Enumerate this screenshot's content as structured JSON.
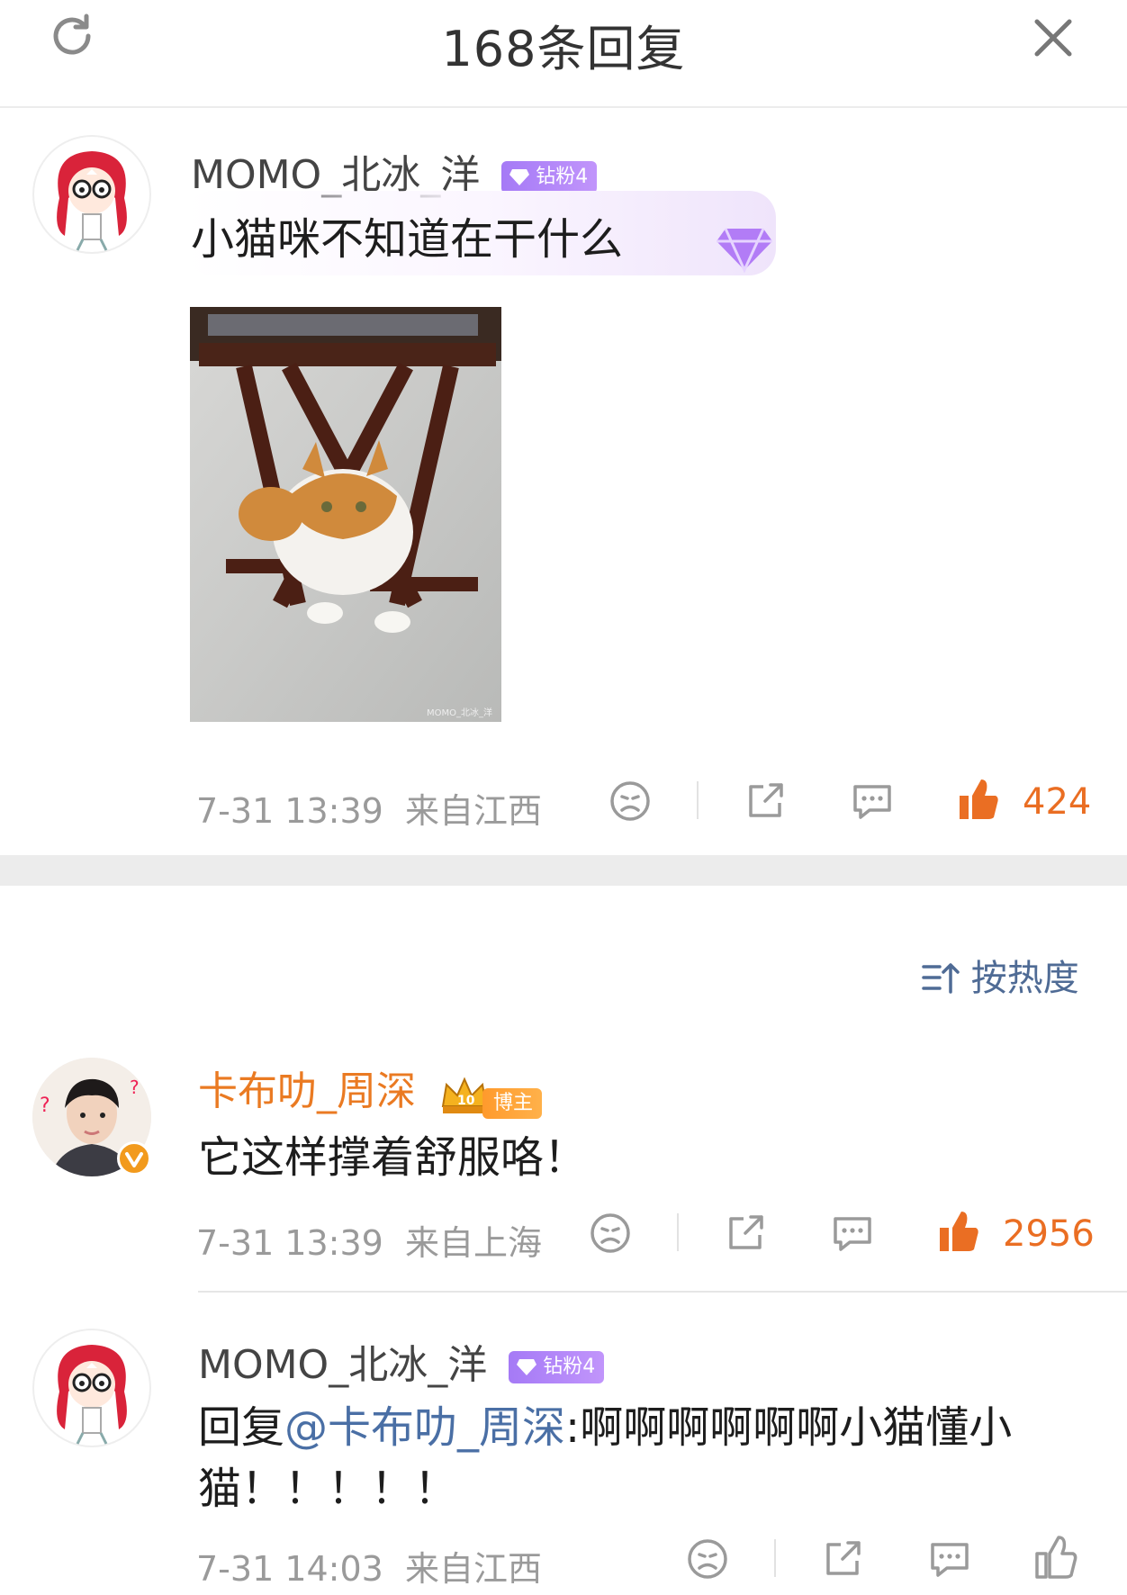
{
  "header": {
    "title": "168条回复"
  },
  "main_comment": {
    "username": "MOMO_北冰_洋",
    "badge": "钻粉4",
    "text": "小猫咪不知道在干什么",
    "image_watermark": "MOMO_北冰_洋",
    "time": "7-31 13:39",
    "location": "来自江西",
    "likes": "424"
  },
  "sort": {
    "label": "按热度"
  },
  "replies": [
    {
      "username": "卡布叻_周深",
      "badge": "博主",
      "text": "它这样撑着舒服咯！",
      "time": "7-31 13:39",
      "location": "来自上海",
      "likes": "2956"
    },
    {
      "username": "MOMO_北冰_洋",
      "badge": "钻粉4",
      "reply_prefix": "回复",
      "mention": "@卡布叻_周深",
      "text_line1": ":啊啊啊啊啊啊小猫懂小",
      "text_line2": "猫！！！！！",
      "time": "7-31 14:03",
      "location": "来自江西",
      "likes": ""
    }
  ],
  "colors": {
    "accent_orange": "#ea6e23",
    "badge_purple": "#a57af6",
    "link_blue": "#4a6fa5"
  },
  "icons": [
    "refresh-icon",
    "close-icon",
    "dislike-icon",
    "share-icon",
    "comment-icon",
    "like-icon"
  ]
}
